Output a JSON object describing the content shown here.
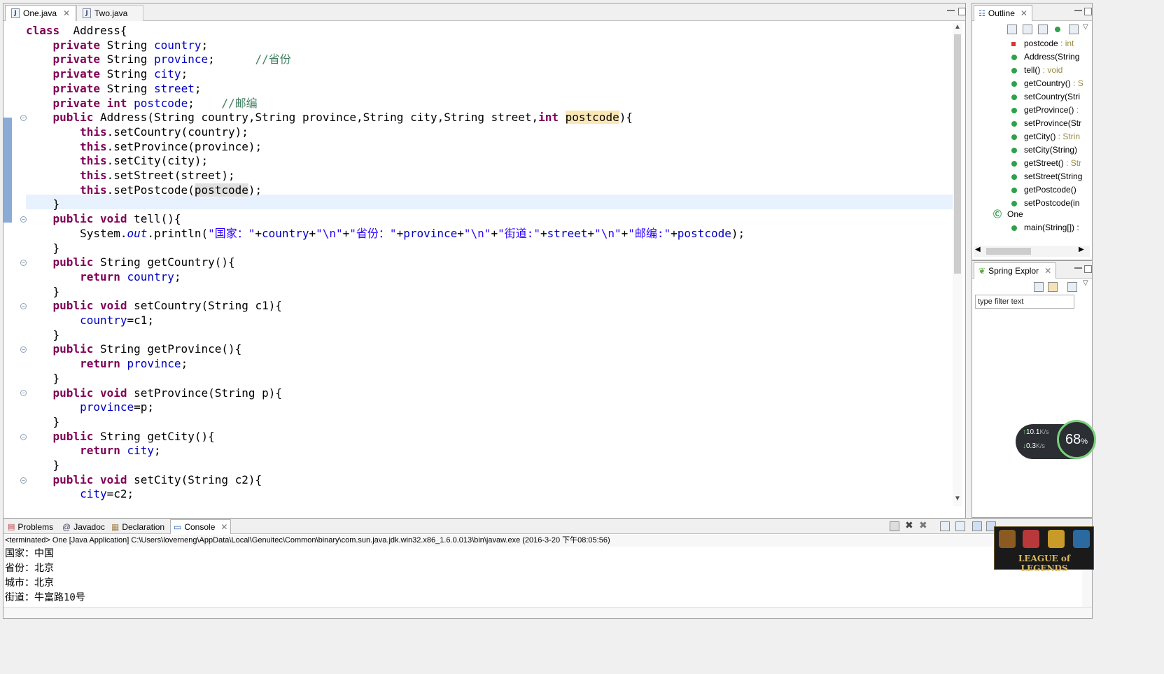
{
  "editor": {
    "tabs": [
      {
        "label": "One.java",
        "active": true
      },
      {
        "label": "Two.java",
        "active": false
      }
    ],
    "code_lines": [
      {
        "segs": [
          [
            "kw",
            "class"
          ],
          [
            "",
            "  Address{"
          ]
        ]
      },
      {
        "segs": [
          [
            "",
            "    "
          ],
          [
            "kw",
            "private"
          ],
          [
            "",
            " String "
          ],
          [
            "fd",
            "country"
          ],
          [
            "",
            ";"
          ]
        ]
      },
      {
        "segs": [
          [
            "",
            "    "
          ],
          [
            "kw",
            "private"
          ],
          [
            "",
            " String "
          ],
          [
            "fd",
            "province"
          ],
          [
            "",
            ";      "
          ],
          [
            "cm",
            "//省份"
          ]
        ]
      },
      {
        "segs": [
          [
            "",
            "    "
          ],
          [
            "kw",
            "private"
          ],
          [
            "",
            " String "
          ],
          [
            "fd",
            "city"
          ],
          [
            "",
            ";"
          ]
        ]
      },
      {
        "segs": [
          [
            "",
            "    "
          ],
          [
            "kw",
            "private"
          ],
          [
            "",
            " String "
          ],
          [
            "fd",
            "street"
          ],
          [
            "",
            ";"
          ]
        ]
      },
      {
        "segs": [
          [
            "",
            "    "
          ],
          [
            "kw",
            "private"
          ],
          [
            "",
            ""
          ],
          [
            "kw",
            " int"
          ],
          [
            "",
            " "
          ],
          [
            "fd",
            "postcode"
          ],
          [
            "",
            ";    "
          ],
          [
            "cm",
            "//邮编"
          ]
        ]
      },
      {
        "segs": [
          [
            "",
            "    "
          ],
          [
            "kw",
            "public"
          ],
          [
            "",
            " Address(String country,String province,String city,String street,"
          ],
          [
            "kw",
            "int"
          ],
          [
            "",
            " "
          ],
          [
            "hl",
            "postcode"
          ],
          [
            "",
            "){"
          ]
        ]
      },
      {
        "segs": [
          [
            "",
            "        "
          ],
          [
            "kw",
            "this"
          ],
          [
            "",
            ".setCountry(country);"
          ]
        ]
      },
      {
        "segs": [
          [
            "",
            "        "
          ],
          [
            "kw",
            "this"
          ],
          [
            "",
            ".setProvince(province);"
          ]
        ]
      },
      {
        "segs": [
          [
            "",
            "        "
          ],
          [
            "kw",
            "this"
          ],
          [
            "",
            ".setCity(city);"
          ]
        ]
      },
      {
        "segs": [
          [
            "",
            "        "
          ],
          [
            "kw",
            "this"
          ],
          [
            "",
            ".setStreet(street);"
          ]
        ]
      },
      {
        "segs": [
          [
            "",
            "        "
          ],
          [
            "kw",
            "this"
          ],
          [
            "",
            ".setPostcode("
          ],
          [
            "hl2",
            "postcode"
          ],
          [
            "",
            ");"
          ]
        ]
      },
      {
        "segs": [
          [
            "",
            "    }"
          ]
        ]
      },
      {
        "segs": [
          [
            "",
            "    "
          ],
          [
            "kw",
            "public"
          ],
          [
            "",
            ""
          ],
          [
            "kw",
            " void"
          ],
          [
            "",
            " tell(){"
          ]
        ]
      },
      {
        "segs": [
          [
            "",
            "        System."
          ],
          [
            "fdit",
            "out"
          ],
          [
            "",
            ".println("
          ],
          [
            "st",
            "\"国家：\""
          ],
          [
            "",
            "+"
          ],
          [
            "fd",
            "country"
          ],
          [
            "",
            "+"
          ],
          [
            "st",
            "\"\\n\""
          ],
          [
            "",
            "+"
          ],
          [
            "st",
            "\"省份：\""
          ],
          [
            "",
            "+"
          ],
          [
            "fd",
            "province"
          ],
          [
            "",
            "+"
          ],
          [
            "st",
            "\"\\n\""
          ],
          [
            "",
            "+"
          ],
          [
            "st",
            "\"街道:\""
          ],
          [
            "",
            "+"
          ],
          [
            "fd",
            "street"
          ],
          [
            "",
            "+"
          ],
          [
            "st",
            "\"\\n\""
          ],
          [
            "",
            "+"
          ],
          [
            "st",
            "\"邮编:\""
          ],
          [
            "",
            "+"
          ],
          [
            "fd",
            "postcode"
          ],
          [
            "",
            ");"
          ]
        ]
      },
      {
        "segs": [
          [
            "",
            "    }"
          ]
        ]
      },
      {
        "segs": [
          [
            "",
            "    "
          ],
          [
            "kw",
            "public"
          ],
          [
            "",
            " String getCountry(){"
          ]
        ]
      },
      {
        "segs": [
          [
            "",
            "        "
          ],
          [
            "kw",
            "return"
          ],
          [
            "",
            " "
          ],
          [
            "fd",
            "country"
          ],
          [
            "",
            ";"
          ]
        ]
      },
      {
        "segs": [
          [
            "",
            "    }"
          ]
        ]
      },
      {
        "segs": [
          [
            "",
            "    "
          ],
          [
            "kw",
            "public"
          ],
          [
            "",
            ""
          ],
          [
            "kw",
            " void"
          ],
          [
            "",
            " setCountry(String c1){"
          ]
        ]
      },
      {
        "segs": [
          [
            "",
            "        "
          ],
          [
            "fd",
            "country"
          ],
          [
            "",
            "=c1;"
          ]
        ]
      },
      {
        "segs": [
          [
            "",
            "    }"
          ]
        ]
      },
      {
        "segs": [
          [
            "",
            "    "
          ],
          [
            "kw",
            "public"
          ],
          [
            "",
            " String getProvince(){"
          ]
        ]
      },
      {
        "segs": [
          [
            "",
            "        "
          ],
          [
            "kw",
            "return"
          ],
          [
            "",
            " "
          ],
          [
            "fd",
            "province"
          ],
          [
            "",
            ";"
          ]
        ]
      },
      {
        "segs": [
          [
            "",
            "    }"
          ]
        ]
      },
      {
        "segs": [
          [
            "",
            "    "
          ],
          [
            "kw",
            "public"
          ],
          [
            "",
            ""
          ],
          [
            "kw",
            " void"
          ],
          [
            "",
            " setProvince(String p){"
          ]
        ]
      },
      {
        "segs": [
          [
            "",
            "        "
          ],
          [
            "fd",
            "province"
          ],
          [
            "",
            "=p;"
          ]
        ]
      },
      {
        "segs": [
          [
            "",
            "    }"
          ]
        ]
      },
      {
        "segs": [
          [
            "",
            "    "
          ],
          [
            "kw",
            "public"
          ],
          [
            "",
            " String getCity(){"
          ]
        ]
      },
      {
        "segs": [
          [
            "",
            "        "
          ],
          [
            "kw",
            "return"
          ],
          [
            "",
            " "
          ],
          [
            "fd",
            "city"
          ],
          [
            "",
            ";"
          ]
        ]
      },
      {
        "segs": [
          [
            "",
            "    }"
          ]
        ]
      },
      {
        "segs": [
          [
            "",
            "    "
          ],
          [
            "kw",
            "public"
          ],
          [
            "",
            ""
          ],
          [
            "kw",
            " void"
          ],
          [
            "",
            " setCity(String c2){"
          ]
        ]
      },
      {
        "segs": [
          [
            "",
            "        "
          ],
          [
            "fd",
            "city"
          ],
          [
            "",
            "=c2;"
          ]
        ]
      }
    ]
  },
  "outline": {
    "tab_label": "Outline",
    "items": [
      {
        "name": "postcode",
        "type": " : int",
        "icon": "private-field-icon"
      },
      {
        "name": "Address(String",
        "type": "",
        "icon": "constructor-icon"
      },
      {
        "name": "tell()",
        "type": " : void",
        "icon": "public-method-icon"
      },
      {
        "name": "getCountry()",
        "type": " : S",
        "icon": "public-method-icon"
      },
      {
        "name": "setCountry(Stri",
        "type": "",
        "icon": "public-method-icon"
      },
      {
        "name": "getProvince()",
        "type": " :",
        "icon": "public-method-icon"
      },
      {
        "name": "setProvince(Str",
        "type": "",
        "icon": "public-method-icon"
      },
      {
        "name": "getCity()",
        "type": " : Strin",
        "icon": "public-method-icon"
      },
      {
        "name": "setCity(String)",
        "type": "",
        "icon": "public-method-icon"
      },
      {
        "name": "getStreet()",
        "type": " : Str",
        "icon": "public-method-icon"
      },
      {
        "name": "setStreet(String",
        "type": "",
        "icon": "public-method-icon"
      },
      {
        "name": "getPostcode()",
        "type": "",
        "icon": "public-method-icon"
      },
      {
        "name": "setPostcode(in",
        "type": "",
        "icon": "public-method-icon"
      }
    ],
    "class_item": "One",
    "main_item": "main(String[]) :"
  },
  "spring": {
    "tab_label": "Spring Explor",
    "filter_placeholder": "type filter text"
  },
  "console": {
    "tabs": [
      {
        "label": "Problems",
        "icon": "problems-icon"
      },
      {
        "label": "Javadoc",
        "icon": "javadoc-icon"
      },
      {
        "label": "Declaration",
        "icon": "declaration-icon"
      },
      {
        "label": "Console",
        "icon": "console-icon"
      }
    ],
    "terminated": "<terminated> One [Java Application] C:\\Users\\loverneng\\AppData\\Local\\Genuitec\\Common\\binary\\com.sun.java.jdk.win32.x86_1.6.0.013\\bin\\javaw.exe (2016-3-20 下午08:05:56)",
    "output": [
      "国家：中国",
      "省份：北京",
      "城市：北京",
      "街道：牛富路10号"
    ]
  },
  "net_widget": {
    "up": "10.1",
    "up_unit": "K/s",
    "down": "0.3",
    "down_unit": "K/s",
    "percent": "68",
    "percent_unit": "%"
  },
  "banner": {
    "text": "LEAGUE of LEGENDS"
  },
  "colors": {
    "keyword": "#7f0055",
    "field": "#0000c0",
    "string": "#2a00ff",
    "comment": "#3f7f5f"
  }
}
